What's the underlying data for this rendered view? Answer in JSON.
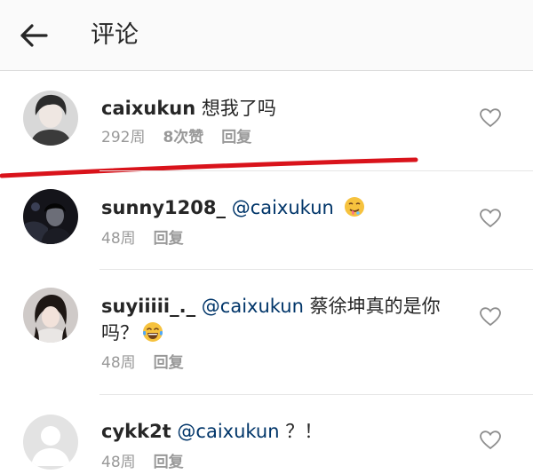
{
  "header": {
    "back_icon": "arrow-left-icon",
    "title": "评论"
  },
  "comments": [
    {
      "username": "caixukun",
      "mention": "",
      "text": "想我了吗",
      "time": "292周",
      "likes": "8次赞",
      "reply": "回复",
      "avatar": "photo-avatar",
      "like_icon": "heart-outline-icon"
    },
    {
      "username": "sunny1208_",
      "mention": "@caixukun",
      "text": "",
      "emoji": "drooling-face-emoji",
      "time": "48周",
      "reply": "回复",
      "avatar": "photo-avatar",
      "like_icon": "heart-outline-icon"
    },
    {
      "username": "suyiiiii_._",
      "mention": "@caixukun",
      "text": "蔡徐坤真的是你吗？",
      "emoji": "tears-of-joy-emoji",
      "time": "48周",
      "reply": "回复",
      "avatar": "photo-avatar",
      "like_icon": "heart-outline-icon"
    },
    {
      "username": "cykk2t",
      "mention": "@caixukun",
      "text": "？！",
      "time": "48周",
      "reply": "回复",
      "avatar": "default-avatar",
      "like_icon": "heart-outline-icon"
    }
  ],
  "colors": {
    "mention": "#003569",
    "meta": "#999999",
    "annotation_line": "#d9131b"
  }
}
